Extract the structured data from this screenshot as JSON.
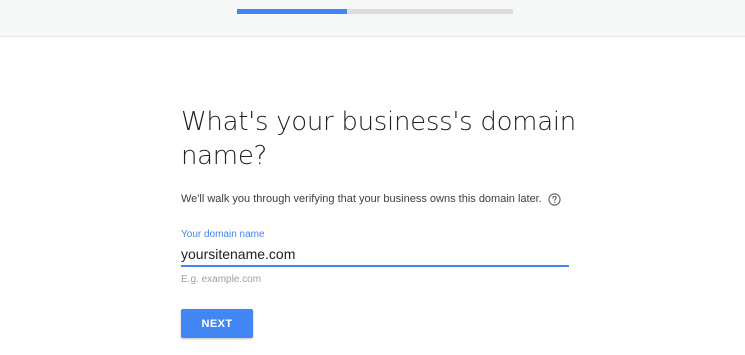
{
  "progress": {
    "fraction": 0.4,
    "fill_color": "#4285f4",
    "track_color": "#dcdcdc"
  },
  "page": {
    "title": "What's your business's domain name?",
    "subtitle": "We'll walk you through verifying that your business owns this domain later.",
    "help_icon": "question-circle-icon"
  },
  "domain_field": {
    "label": "Your domain name",
    "value": "yoursitename.com",
    "hint": "E.g. example.com"
  },
  "actions": {
    "next_label": "NEXT"
  },
  "colors": {
    "accent": "#4285f4"
  }
}
